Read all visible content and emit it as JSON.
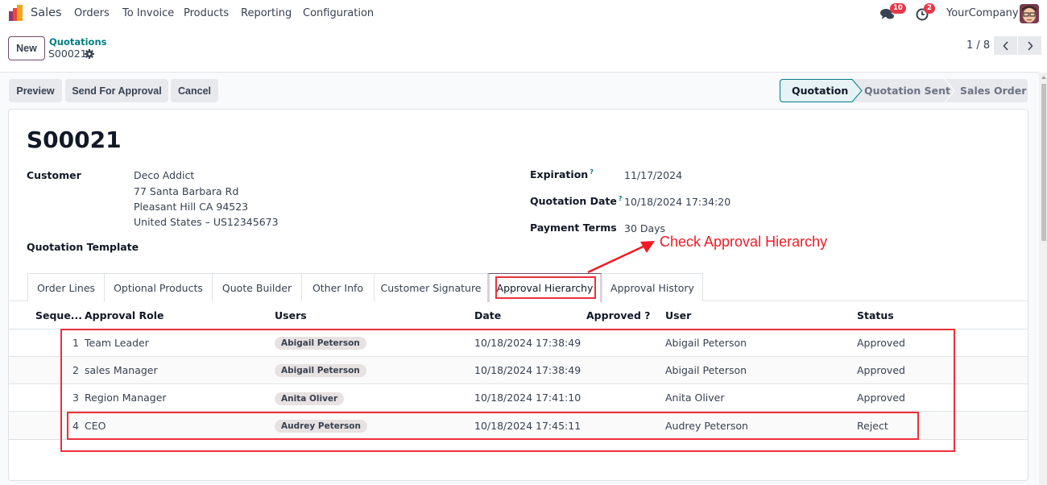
{
  "navbar": {
    "app_name": "Sales",
    "menu": [
      "Orders",
      "To Invoice",
      "Products",
      "Reporting",
      "Configuration"
    ],
    "messages_badge": "10",
    "activities_badge": "2",
    "company": "YourCompany",
    "icons": {
      "messages": "chat-icon",
      "activities": "clock-icon",
      "avatar": "user-avatar"
    }
  },
  "control": {
    "new_label": "New",
    "breadcrumb_parent": "Quotations",
    "breadcrumb_current": "S00021",
    "pager": "1 / 8"
  },
  "actions": {
    "preview": "Preview",
    "send_for_approval": "Send For Approval",
    "cancel": "Cancel"
  },
  "statusbar": {
    "stages": [
      "Quotation",
      "Quotation Sent",
      "Sales Order"
    ],
    "active": "Quotation"
  },
  "form": {
    "title": "S00021",
    "customer_label": "Customer",
    "customer_lines": [
      "Deco Addict",
      "77 Santa Barbara Rd",
      "Pleasant Hill CA 94523",
      "United States – US12345673"
    ],
    "quotation_template_label": "Quotation Template",
    "expiration_label": "Expiration",
    "expiration_value": "11/17/2024",
    "quotation_date_label": "Quotation Date",
    "quotation_date_value": "10/18/2024 17:34:20",
    "payment_terms_label": "Payment Terms",
    "payment_terms_value": "30 Days",
    "help_mark": "?"
  },
  "annotation": {
    "text": "Check Approval Hierarchy",
    "color": "#ee1c25"
  },
  "tabs": [
    "Order Lines",
    "Optional Products",
    "Quote Builder",
    "Other Info",
    "Customer Signature",
    "Approval Hierarchy",
    "Approval History"
  ],
  "active_tab": "Approval Hierarchy",
  "table": {
    "headers": [
      "Seque...",
      "Approval Role",
      "Users",
      "Date",
      "Approved ?",
      "User",
      "Status"
    ],
    "rows": [
      {
        "seq": "1",
        "role": "Team Leader",
        "users": "Abigail Peterson",
        "date": "10/18/2024 17:38:49",
        "approved": "",
        "user": "Abigail Peterson",
        "status": "Approved"
      },
      {
        "seq": "2",
        "role": "sales Manager",
        "users": "Abigail Peterson",
        "date": "10/18/2024 17:38:49",
        "approved": "",
        "user": "Abigail Peterson",
        "status": "Approved"
      },
      {
        "seq": "3",
        "role": "Region Manager",
        "users": "Anita Oliver",
        "date": "10/18/2024 17:41:10",
        "approved": "",
        "user": "Anita Oliver",
        "status": "Approved"
      },
      {
        "seq": "4",
        "role": "CEO",
        "users": "Audrey Peterson",
        "date": "10/18/2024 17:45:11",
        "approved": "",
        "user": "Audrey Peterson",
        "status": "Reject"
      }
    ]
  }
}
